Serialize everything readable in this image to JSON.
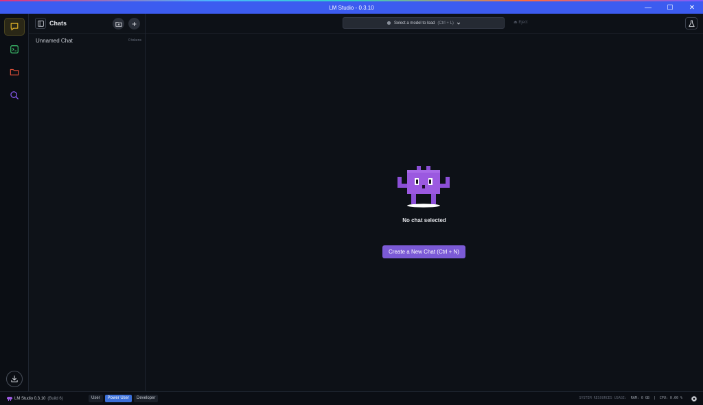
{
  "window": {
    "title": "LM Studio - 0.3.10",
    "controls": {
      "minimize": "—",
      "maximize": "☐",
      "close": "✕"
    }
  },
  "rail": {
    "items": [
      {
        "name": "chat",
        "icon": "chat-bubble-icon",
        "color": "#e5b62a",
        "active": true
      },
      {
        "name": "developer",
        "icon": "terminal-icon",
        "color": "#3ec46d",
        "active": false
      },
      {
        "name": "my-models",
        "icon": "folder-icon",
        "color": "#e8533a",
        "active": false
      },
      {
        "name": "discover",
        "icon": "search-icon",
        "color": "#8b5cf6",
        "active": false
      }
    ],
    "bottom_icon": "download-icon"
  },
  "sidebar": {
    "title": "Chats",
    "new_folder_icon": "new-folder-icon",
    "new_chat_label": "+",
    "chats": [
      {
        "name": "Unnamed Chat",
        "tokens": "0 tokens"
      }
    ]
  },
  "topbar": {
    "model_select_label": "Select a model to load",
    "model_select_shortcut": "(Ctrl + L)",
    "eject_label": "Eject"
  },
  "main": {
    "empty_message": "No chat selected",
    "create_button": "Create a New Chat (Ctrl + N)"
  },
  "statusbar": {
    "app_name": "LM Studio 0.3.10",
    "build": "(Build 6)",
    "modes": [
      {
        "label": "User",
        "active": false
      },
      {
        "label": "Power User",
        "active": true
      },
      {
        "label": "Developer",
        "active": false
      }
    ],
    "system_label": "SYSTEM RESOURCES USAGE:",
    "ram": "RAM: 0 GB",
    "separator": "|",
    "cpu": "CPU: 0.00 %"
  },
  "colors": {
    "accent": "#7b5ad6",
    "titlebar": "#3c5cf0",
    "mode_active": "#3b6fd8"
  }
}
